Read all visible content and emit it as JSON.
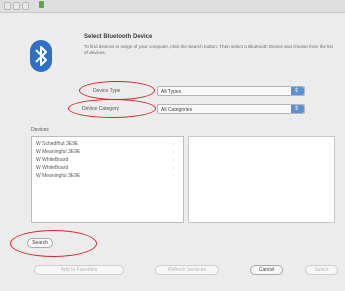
{
  "dialog": {
    "heading": "Select Bluetooth Device",
    "description": "To find devices in range of your computer, click the Search button. Then select a Bluetooth Device and choose from the list of devices."
  },
  "filters": {
    "device_type_label": "Device Type",
    "device_type_value": "All Types",
    "device_category_label": "Device Category",
    "device_category_value": "All Categories"
  },
  "devices": {
    "label": "Devices",
    "items": [
      "W Schedfhut 3E9E",
      "W Meaningful 3E9E",
      "W WhiteBoard",
      "W WhiteBoard",
      "W Meaningful 3E9E"
    ]
  },
  "buttons": {
    "search": "Search",
    "add_to_favorites": "Add to Favorites",
    "refresh_services": "Refresh Services",
    "cancel": "Cancel",
    "select": "Select"
  },
  "colors": {
    "annotation_red": "#d8262c",
    "bluetooth_blue": "#2f6fc4"
  }
}
